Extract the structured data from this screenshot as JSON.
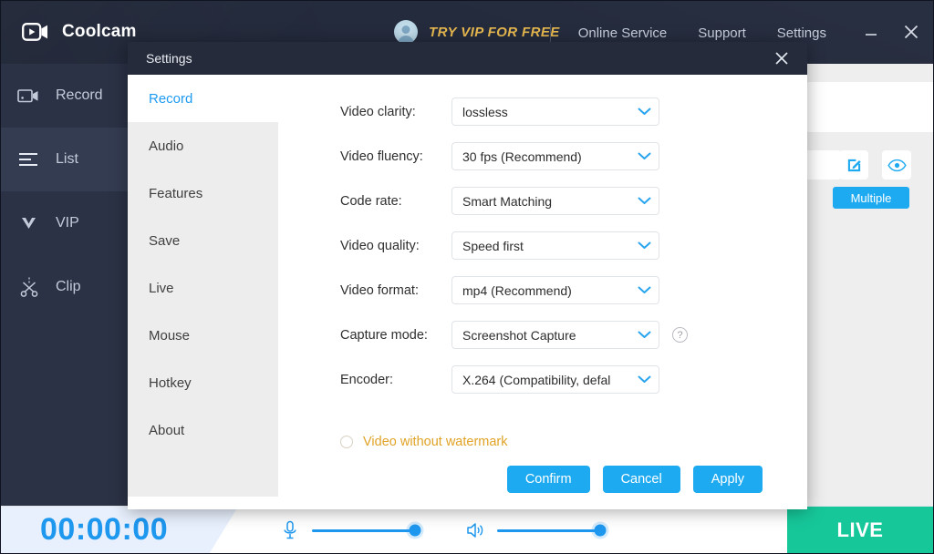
{
  "app": {
    "name": "Coolcam",
    "logo_icon": "video-camera-icon"
  },
  "titlebar": {
    "vip_promo": "TRY VIP FOR FREE",
    "avatar_icon": "user-avatar-icon",
    "nav": [
      {
        "label": "Online Service",
        "name": "online-service"
      },
      {
        "label": "Support",
        "name": "support"
      },
      {
        "label": "Settings",
        "name": "settings"
      }
    ],
    "minimize_icon": "minimize-icon",
    "close_icon": "close-icon"
  },
  "sidebar": {
    "items": [
      {
        "label": "Record",
        "icon": "camcorder-icon",
        "active": false
      },
      {
        "label": "List",
        "icon": "list-lines-icon",
        "active": true
      },
      {
        "label": "VIP",
        "icon": "vip-chevron-icon",
        "active": false
      },
      {
        "label": "Clip",
        "icon": "scissors-icon",
        "active": false
      }
    ]
  },
  "background_panel": {
    "edit_icon": "edit-square-icon",
    "eye_icon": "eye-icon",
    "multiple_button": "Multiple"
  },
  "bottombar": {
    "timer": "00:00:00",
    "mic_icon": "microphone-icon",
    "speaker_icon": "speaker-icon",
    "mic_level": 90,
    "speaker_level": 90,
    "live_button": "LIVE"
  },
  "dialog": {
    "title": "Settings",
    "close_icon": "close-icon",
    "nav": [
      {
        "label": "Record",
        "active": true
      },
      {
        "label": "Audio",
        "active": false
      },
      {
        "label": "Features",
        "active": false
      },
      {
        "label": "Save",
        "active": false
      },
      {
        "label": "Live",
        "active": false
      },
      {
        "label": "Mouse",
        "active": false
      },
      {
        "label": "Hotkey",
        "active": false
      },
      {
        "label": "About",
        "active": false
      }
    ],
    "fields": [
      {
        "label": "Video clarity:",
        "value": "lossless",
        "name": "video-clarity",
        "help": false
      },
      {
        "label": "Video fluency:",
        "value": "30 fps (Recommend)",
        "name": "video-fluency",
        "help": false
      },
      {
        "label": "Code rate:",
        "value": "Smart Matching",
        "name": "code-rate",
        "help": false
      },
      {
        "label": "Video quality:",
        "value": "Speed first",
        "name": "video-quality",
        "help": false
      },
      {
        "label": "Video format:",
        "value": "mp4 (Recommend)",
        "name": "video-format",
        "help": false
      },
      {
        "label": "Capture mode:",
        "value": "Screenshot Capture",
        "name": "capture-mode",
        "help": true
      },
      {
        "label": "Encoder:",
        "value": "X.264 (Compatibility, defal",
        "name": "encoder",
        "help": false
      }
    ],
    "watermark": {
      "label": "Video without watermark",
      "checked": false
    },
    "buttons": [
      {
        "label": "Confirm",
        "name": "confirm-button"
      },
      {
        "label": "Cancel",
        "name": "cancel-button"
      },
      {
        "label": "Apply",
        "name": "apply-button"
      }
    ]
  },
  "colors": {
    "accent_blue": "#1eaaf1",
    "promo_gold": "#e8b94f",
    "live_green": "#16c79a",
    "watermark_orange": "#e0a326",
    "dark_navy": "#242b3d"
  }
}
